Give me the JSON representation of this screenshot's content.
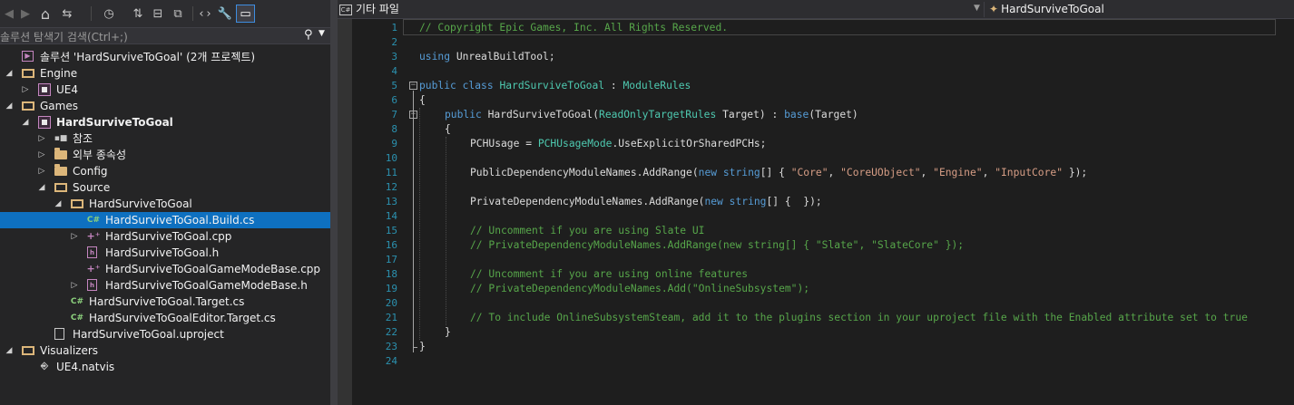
{
  "solution_explorer": {
    "search_placeholder": "솔루션 탐색기 검색(Ctrl+;)",
    "toolbar": {
      "back": "◀",
      "forward": "▶",
      "home": "⌂",
      "sync": "⇆",
      "history": "◷",
      "switch_views": "⇅",
      "collapse": "⊟",
      "show_all": "⧉",
      "view_code": "‹›",
      "properties": "🔧",
      "preview": "▭"
    },
    "tree": [
      {
        "label": "솔루션 'HardSurviveToGoal' (2개 프로젝트)",
        "icon": "solution-icon",
        "depth": 0,
        "arrow": "",
        "bold": false
      },
      {
        "label": "Engine",
        "icon": "folder-open-icon",
        "depth": 0,
        "arrow": "◢",
        "bold": false
      },
      {
        "label": "UE4",
        "icon": "project-icon",
        "depth": 1,
        "arrow": "▷",
        "bold": false
      },
      {
        "label": "Games",
        "icon": "folder-open-icon",
        "depth": 0,
        "arrow": "◢",
        "bold": false
      },
      {
        "label": "HardSurviveToGoal",
        "icon": "project-icon",
        "depth": 1,
        "arrow": "◢",
        "bold": true
      },
      {
        "label": "참조",
        "icon": "references-icon",
        "depth": 2,
        "arrow": "▷",
        "bold": false
      },
      {
        "label": "외부 종속성",
        "icon": "external-deps-icon",
        "depth": 2,
        "arrow": "▷",
        "bold": false
      },
      {
        "label": "Config",
        "icon": "folder-icon",
        "depth": 2,
        "arrow": "▷",
        "bold": false
      },
      {
        "label": "Source",
        "icon": "folder-open-icon",
        "depth": 2,
        "arrow": "◢",
        "bold": false
      },
      {
        "label": "HardSurviveToGoal",
        "icon": "folder-open-icon",
        "depth": 3,
        "arrow": "◢",
        "bold": false
      },
      {
        "label": "HardSurviveToGoal.Build.cs",
        "icon": "csharp-file-icon",
        "depth": 4,
        "arrow": "",
        "bold": false,
        "selected": true
      },
      {
        "label": "HardSurviveToGoal.cpp",
        "icon": "cpp-file-icon",
        "depth": 4,
        "arrow": "▷",
        "bold": false
      },
      {
        "label": "HardSurviveToGoal.h",
        "icon": "header-file-icon",
        "depth": 4,
        "arrow": "",
        "bold": false
      },
      {
        "label": "HardSurviveToGoalGameModeBase.cpp",
        "icon": "cpp-file-icon",
        "depth": 4,
        "arrow": "",
        "bold": false
      },
      {
        "label": "HardSurviveToGoalGameModeBase.h",
        "icon": "header-file-icon",
        "depth": 4,
        "arrow": "▷",
        "bold": false
      },
      {
        "label": "HardSurviveToGoal.Target.cs",
        "icon": "csharp-file-icon",
        "depth": 3,
        "arrow": "",
        "bold": false
      },
      {
        "label": "HardSurviveToGoalEditor.Target.cs",
        "icon": "csharp-file-icon",
        "depth": 3,
        "arrow": "",
        "bold": false
      },
      {
        "label": "HardSurviveToGoal.uproject",
        "icon": "file-icon",
        "depth": 2,
        "arrow": "",
        "bold": false
      },
      {
        "label": "Visualizers",
        "icon": "folder-open-icon",
        "depth": 0,
        "arrow": "◢",
        "bold": false
      },
      {
        "label": "UE4.natvis",
        "icon": "natvis-icon",
        "depth": 1,
        "arrow": "",
        "bold": false
      }
    ]
  },
  "editor": {
    "nav_project": "기타 파일",
    "nav_scope": "HardSurviveToGoal",
    "cs_badge": "C#",
    "lines": [
      {
        "n": "1",
        "indent": 0,
        "tokens": [
          [
            "com",
            "// Copyright Epic Games, Inc. All Rights Reserved."
          ]
        ]
      },
      {
        "n": "2",
        "indent": 0,
        "tokens": []
      },
      {
        "n": "3",
        "indent": 0,
        "tokens": [
          [
            "kw",
            "using"
          ],
          [
            "plain",
            " UnrealBuildTool;"
          ]
        ]
      },
      {
        "n": "4",
        "indent": 0,
        "tokens": []
      },
      {
        "n": "5",
        "indent": 0,
        "tokens": [
          [
            "kw",
            "public"
          ],
          [
            "plain",
            " "
          ],
          [
            "kw",
            "class"
          ],
          [
            "plain",
            " "
          ],
          [
            "type",
            "HardSurviveToGoal"
          ],
          [
            "plain",
            " : "
          ],
          [
            "type",
            "ModuleRules"
          ]
        ]
      },
      {
        "n": "6",
        "indent": 0,
        "tokens": [
          [
            "plain",
            "{"
          ]
        ]
      },
      {
        "n": "7",
        "indent": 1,
        "tokens": [
          [
            "kw",
            "public"
          ],
          [
            "plain",
            " HardSurviveToGoal("
          ],
          [
            "type",
            "ReadOnlyTargetRules"
          ],
          [
            "plain",
            " Target) : "
          ],
          [
            "kw",
            "base"
          ],
          [
            "plain",
            "(Target)"
          ]
        ]
      },
      {
        "n": "8",
        "indent": 1,
        "tokens": [
          [
            "plain",
            "{"
          ]
        ]
      },
      {
        "n": "9",
        "indent": 2,
        "tokens": [
          [
            "plain",
            "PCHUsage = "
          ],
          [
            "type",
            "PCHUsageMode"
          ],
          [
            "plain",
            ".UseExplicitOrSharedPCHs;"
          ]
        ]
      },
      {
        "n": "10",
        "indent": 0,
        "tokens": []
      },
      {
        "n": "11",
        "indent": 2,
        "tokens": [
          [
            "plain",
            "PublicDependencyModuleNames.AddRange("
          ],
          [
            "kw",
            "new"
          ],
          [
            "plain",
            " "
          ],
          [
            "kw",
            "string"
          ],
          [
            "plain",
            "[] { "
          ],
          [
            "str",
            "\"Core\""
          ],
          [
            "plain",
            ", "
          ],
          [
            "str",
            "\"CoreUObject\""
          ],
          [
            "plain",
            ", "
          ],
          [
            "str",
            "\"Engine\""
          ],
          [
            "plain",
            ", "
          ],
          [
            "str",
            "\"InputCore\""
          ],
          [
            "plain",
            " });"
          ]
        ]
      },
      {
        "n": "12",
        "indent": 0,
        "tokens": []
      },
      {
        "n": "13",
        "indent": 2,
        "tokens": [
          [
            "plain",
            "PrivateDependencyModuleNames.AddRange("
          ],
          [
            "kw",
            "new"
          ],
          [
            "plain",
            " "
          ],
          [
            "kw",
            "string"
          ],
          [
            "plain",
            "[] {  });"
          ]
        ]
      },
      {
        "n": "14",
        "indent": 0,
        "tokens": []
      },
      {
        "n": "15",
        "indent": 2,
        "tokens": [
          [
            "com",
            "// Uncomment if you are using Slate UI"
          ]
        ]
      },
      {
        "n": "16",
        "indent": 2,
        "tokens": [
          [
            "com",
            "// PrivateDependencyModuleNames.AddRange(new string[] { \"Slate\", \"SlateCore\" });"
          ]
        ]
      },
      {
        "n": "17",
        "indent": 0,
        "tokens": []
      },
      {
        "n": "18",
        "indent": 2,
        "tokens": [
          [
            "com",
            "// Uncomment if you are using online features"
          ]
        ]
      },
      {
        "n": "19",
        "indent": 2,
        "tokens": [
          [
            "com",
            "// PrivateDependencyModuleNames.Add(\"OnlineSubsystem\");"
          ]
        ]
      },
      {
        "n": "20",
        "indent": 0,
        "tokens": []
      },
      {
        "n": "21",
        "indent": 2,
        "tokens": [
          [
            "com",
            "// To include OnlineSubsystemSteam, add it to the plugins section in your uproject file with the Enabled attribute set to true"
          ]
        ]
      },
      {
        "n": "22",
        "indent": 1,
        "tokens": [
          [
            "plain",
            "}"
          ]
        ]
      },
      {
        "n": "23",
        "indent": 0,
        "tokens": [
          [
            "plain",
            "}"
          ]
        ]
      },
      {
        "n": "24",
        "indent": 0,
        "tokens": []
      }
    ]
  }
}
